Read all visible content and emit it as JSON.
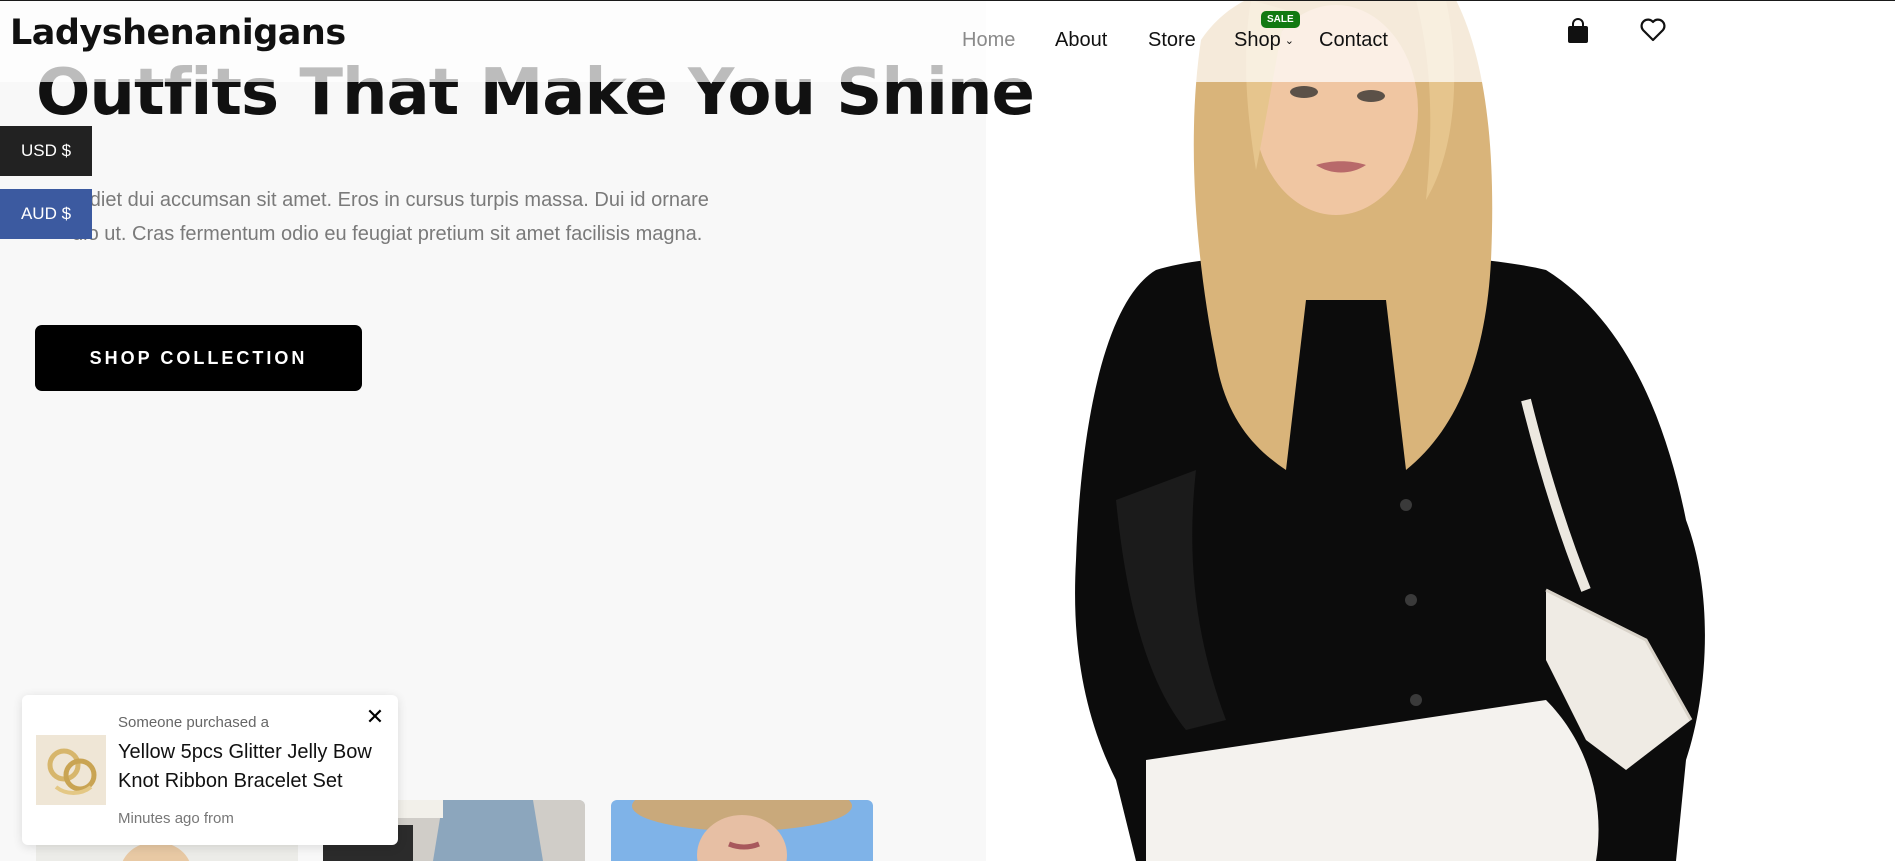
{
  "brand": {
    "name": "Ladyshenanigans"
  },
  "nav": {
    "items": [
      {
        "label": "Home",
        "active": true
      },
      {
        "label": "About"
      },
      {
        "label": "Store"
      },
      {
        "label": "Shop",
        "has_dropdown": true,
        "badge": "SALE"
      },
      {
        "label": "Contact"
      }
    ]
  },
  "header_icons": {
    "cart": "shopping-bag-icon",
    "wishlist": "heart-icon"
  },
  "currency": {
    "options": [
      "USD $",
      "AUD $"
    ]
  },
  "hero": {
    "title": "Outfits That Make You Shine",
    "description": "erdiet dui accumsan sit amet. Eros in cursus turpis massa. Dui id ornare dio ut. Cras fermentum odio eu feugiat pretium sit amet facilisis magna.",
    "cta_label": "SHOP COLLECTION"
  },
  "popup": {
    "pretext": "Someone purchased a",
    "product": "Yellow 5pcs Glitter Jelly Bow Knot Ribbon Bracelet Set",
    "time": "Minutes ago from",
    "close_icon": "close-icon"
  },
  "colors": {
    "sale_badge": "#127a12",
    "cta_bg": "#000000",
    "aud_tab": "#3c5aa0",
    "usd_tab": "#222222",
    "nav_active": "#8a8a8a"
  }
}
